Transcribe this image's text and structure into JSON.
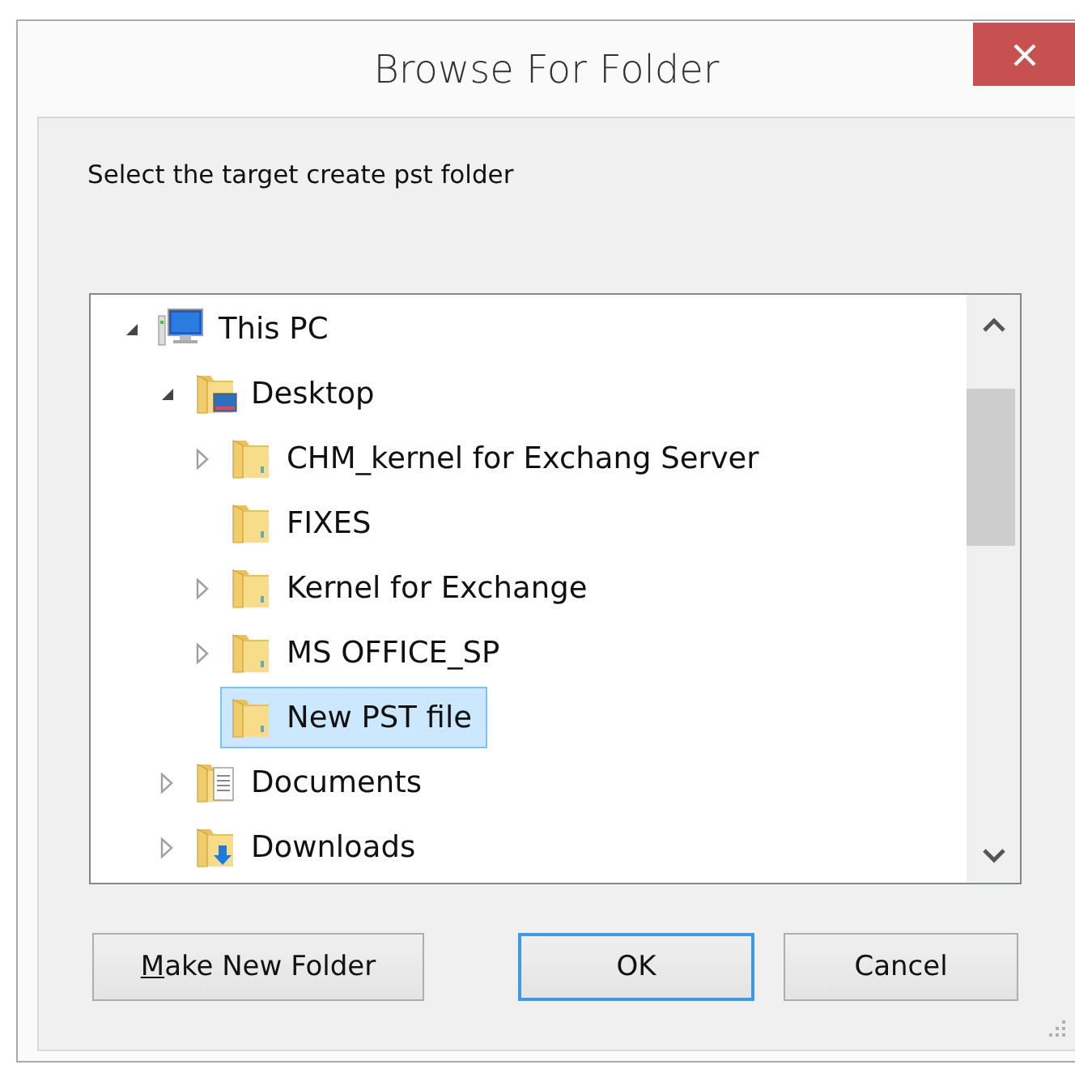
{
  "window": {
    "title": "Browse For Folder"
  },
  "instruction": "Select the target create pst folder",
  "tree": [
    {
      "label": "This PC",
      "kind": "computer",
      "expandable": true,
      "expanded": true,
      "selected": false,
      "children": [
        {
          "label": "Desktop",
          "kind": "desktop",
          "expandable": true,
          "expanded": true,
          "selected": false,
          "children": [
            {
              "label": "CHM_kernel for Exchang Server",
              "kind": "folder",
              "expandable": true,
              "expanded": false,
              "selected": false
            },
            {
              "label": "FIXES",
              "kind": "folder",
              "expandable": false,
              "selected": false
            },
            {
              "label": "Kernel for Exchange",
              "kind": "folder",
              "expandable": true,
              "expanded": false,
              "selected": false
            },
            {
              "label": "MS OFFICE_SP",
              "kind": "folder",
              "expandable": true,
              "expanded": false,
              "selected": false
            },
            {
              "label": "New PST file",
              "kind": "folder",
              "expandable": false,
              "selected": true
            }
          ]
        },
        {
          "label": "Documents",
          "kind": "documents",
          "expandable": true,
          "expanded": false,
          "selected": false
        },
        {
          "label": "Downloads",
          "kind": "downloads",
          "expandable": true,
          "expanded": false,
          "selected": false
        }
      ]
    }
  ],
  "buttons": [
    {
      "label": "Make New Folder",
      "default": false,
      "underline_first": true
    },
    {
      "label": "OK",
      "default": true,
      "underline_first": false
    },
    {
      "label": "Cancel",
      "default": false,
      "underline_first": false
    }
  ]
}
